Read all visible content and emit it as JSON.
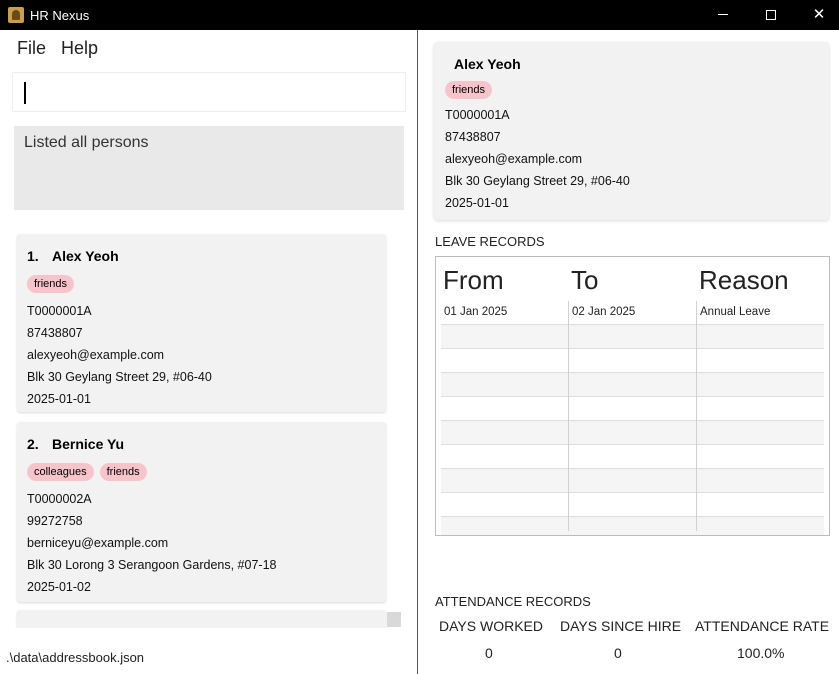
{
  "window": {
    "title": "HR Nexus"
  },
  "menu": {
    "file": "File",
    "help": "Help"
  },
  "command": {
    "value": ""
  },
  "result": {
    "text": "Listed all persons"
  },
  "persons": [
    {
      "index": "1.",
      "name": "Alex Yeoh",
      "tags": [
        "friends"
      ],
      "id": "T0000001A",
      "phone": "87438807",
      "email": "alexyeoh@example.com",
      "address": "Blk 30 Geylang Street 29, #06-40",
      "date": "2025-01-01"
    },
    {
      "index": "2.",
      "name": "Bernice Yu",
      "tags": [
        "colleagues",
        "friends"
      ],
      "id": "T0000002A",
      "phone": "99272758",
      "email": "berniceyu@example.com",
      "address": "Blk 30 Lorong 3 Serangoon Gardens, #07-18",
      "date": "2025-01-02"
    }
  ],
  "status": {
    "path": ".\\data\\addressbook.json"
  },
  "detail": {
    "name": "Alex Yeoh",
    "tags": [
      "friends"
    ],
    "id": "T0000001A",
    "phone": "87438807",
    "email": "alexyeoh@example.com",
    "address": "Blk 30 Geylang Street 29, #06-40",
    "date": "2025-01-01"
  },
  "leave": {
    "title": "LEAVE RECORDS",
    "columns": [
      "From",
      "To",
      "Reason"
    ],
    "rows": [
      [
        "01 Jan 2025",
        "02 Jan 2025",
        "Annual Leave"
      ]
    ]
  },
  "attendance": {
    "title": "ATTENDANCE RECORDS",
    "headers": [
      "DAYS WORKED",
      "DAYS SINCE HIRE",
      "ATTENDANCE RATE"
    ],
    "values": [
      "0",
      "0",
      "100.0%"
    ]
  },
  "colors": {
    "tag": "#f8c4cc",
    "titlebar": "#000000",
    "card": "#f2f2f2"
  }
}
